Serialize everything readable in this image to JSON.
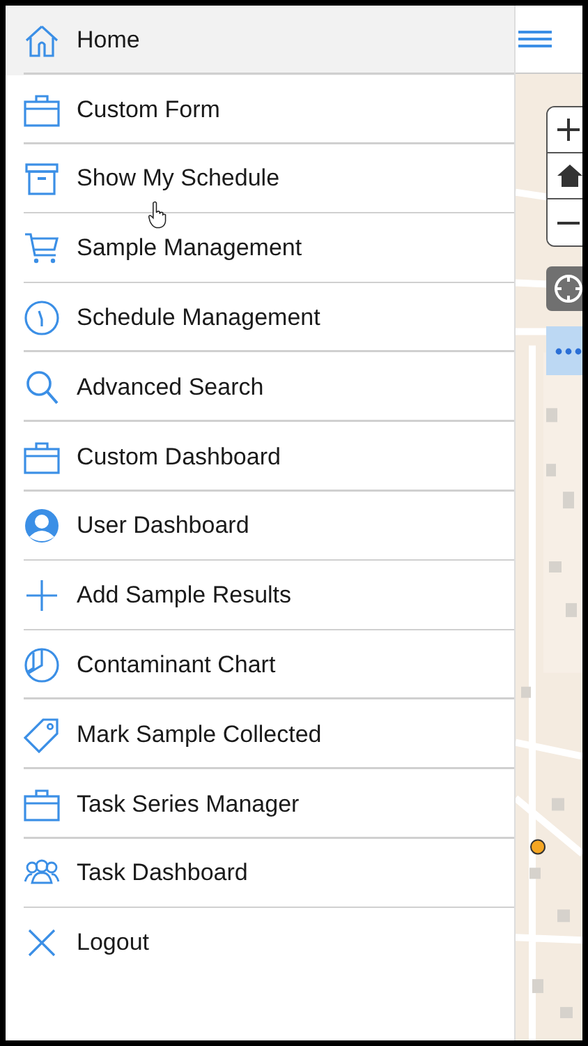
{
  "menu": {
    "items": [
      {
        "label": "Home",
        "kind": "home",
        "selected": true
      },
      {
        "label": "Custom Form",
        "kind": "briefcase",
        "selected": false
      },
      {
        "label": "Show My Schedule",
        "kind": "box",
        "selected": false
      },
      {
        "label": "Sample Management",
        "kind": "cart",
        "selected": false
      },
      {
        "label": "Schedule Management",
        "kind": "clock",
        "selected": false
      },
      {
        "label": "Advanced Search",
        "kind": "search",
        "selected": false
      },
      {
        "label": "Custom Dashboard",
        "kind": "briefcase",
        "selected": false
      },
      {
        "label": "User Dashboard",
        "kind": "user",
        "selected": false
      },
      {
        "label": "Add Sample Results",
        "kind": "plus",
        "selected": false
      },
      {
        "label": "Contaminant Chart",
        "kind": "pie",
        "selected": false
      },
      {
        "label": "Mark Sample Collected",
        "kind": "tag",
        "selected": false
      },
      {
        "label": "Task Series Manager",
        "kind": "briefcase",
        "selected": false
      },
      {
        "label": "Task Dashboard",
        "kind": "people",
        "selected": false
      },
      {
        "label": "Logout",
        "kind": "close",
        "selected": false
      }
    ]
  }
}
